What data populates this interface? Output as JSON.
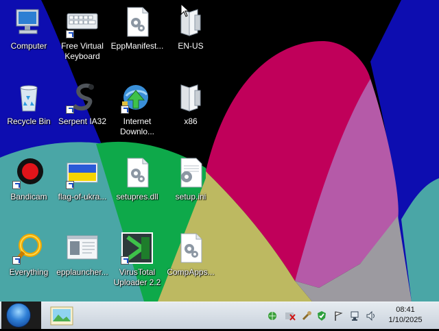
{
  "desktop": {
    "icons": [
      {
        "label": "Computer"
      },
      {
        "label": "Free Virtual\nKeyboard"
      },
      {
        "label": "EppManifest..."
      },
      {
        "label": "EN-US"
      },
      {
        "label": "Recycle Bin"
      },
      {
        "label": "Serpent IA32"
      },
      {
        "label": "Internet\nDownlo..."
      },
      {
        "label": "x86"
      },
      {
        "label": "Bandicam"
      },
      {
        "label": "flag-of-ukra..."
      },
      {
        "label": "setupres.dll"
      },
      {
        "label": "setup.ini"
      },
      {
        "label": "Everything"
      },
      {
        "label": "epplauncher..."
      },
      {
        "label": "VirusTotal\nUploader 2.2"
      },
      {
        "label": "CompApps..."
      }
    ]
  },
  "taskbar": {
    "clock_time": "08:41",
    "clock_date": "1/10/2025"
  }
}
